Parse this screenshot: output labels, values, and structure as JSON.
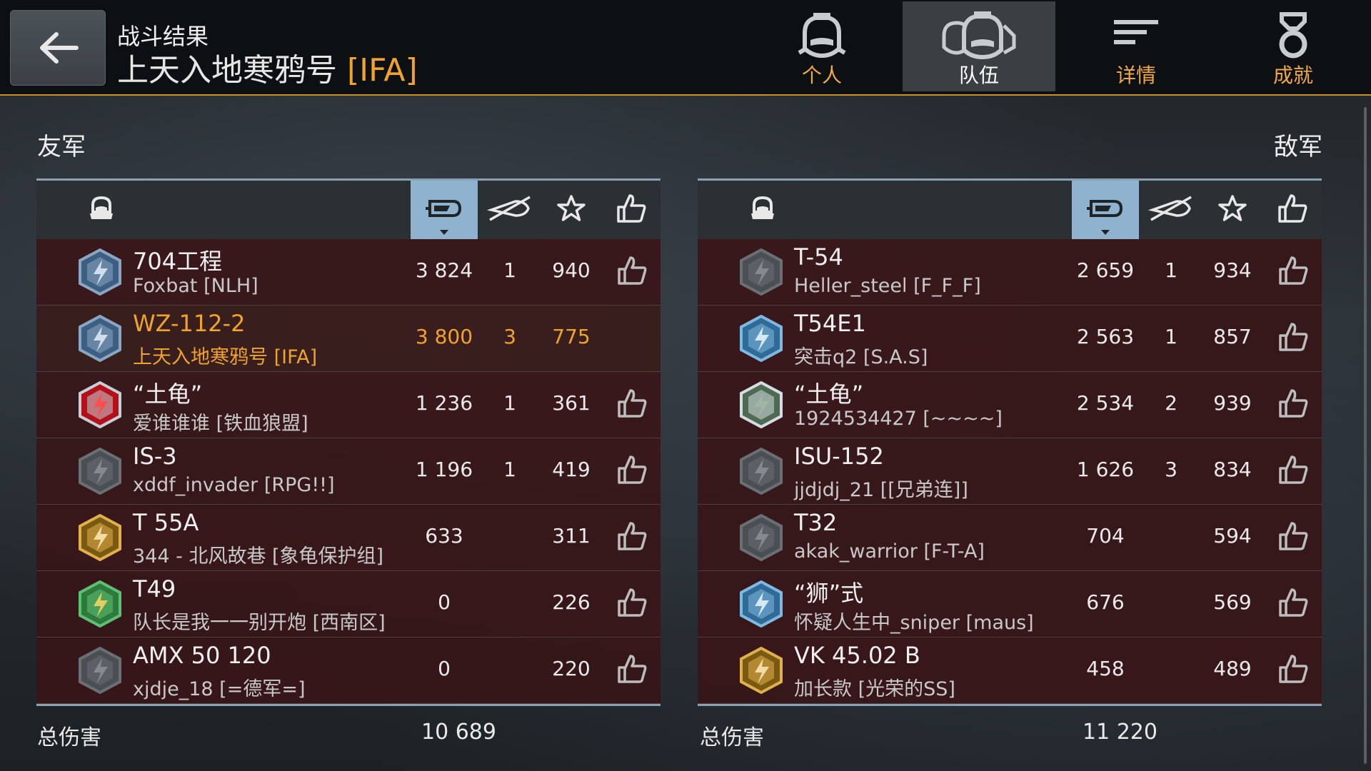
{
  "header": {
    "back_label": "back",
    "subtitle": "战斗结果",
    "title": "上天入地寒鸦号",
    "title_clan": "[IFA]"
  },
  "tabs": [
    {
      "label": "个人",
      "icon": "personal-helmet-icon",
      "active": false
    },
    {
      "label": "队伍",
      "icon": "team-helmets-icon",
      "active": true
    },
    {
      "label": "详情",
      "icon": "details-lines-icon",
      "active": false
    },
    {
      "label": "成就",
      "icon": "medal-icon",
      "active": false
    }
  ],
  "allies": {
    "title": "友军",
    "columns": [
      "tank-icon",
      "damage-icon",
      "kills-icon",
      "experience-star-icon",
      "like-icon"
    ],
    "rows": [
      {
        "tank": "704工程",
        "player": "Foxbat [NLH]",
        "damage": "3 824",
        "kills": "1",
        "xp": "940",
        "tier_icon": "tier-blue-icon",
        "like": true,
        "is_player": false
      },
      {
        "tank": "WZ-112-2",
        "player": "上天入地寒鸦号 [IFA]",
        "damage": "3 800",
        "kills": "3",
        "xp": "775",
        "tier_icon": "tier-blue-icon",
        "like": false,
        "is_player": true
      },
      {
        "tank": "“土龟”",
        "player": "爱谁谁谁 [铁血狼盟]",
        "damage": "1 236",
        "kills": "1",
        "xp": "361",
        "tier_icon": "tier-red-icon",
        "like": true,
        "is_player": false
      },
      {
        "tank": "IS-3",
        "player": "xddf_invader [RPG!!]",
        "damage": "1 196",
        "kills": "1",
        "xp": "419",
        "tier_icon": "tier-gray-icon",
        "like": true,
        "is_player": false
      },
      {
        "tank": "T 55A",
        "player": "344 - 北风故巷 [象龟保护组]",
        "damage": "633",
        "kills": "",
        "xp": "311",
        "tier_icon": "tier-gold-icon",
        "like": true,
        "is_player": false
      },
      {
        "tank": "T49",
        "player": "队长是我一一别开炮 [西南区]",
        "damage": "0",
        "kills": "",
        "xp": "226",
        "tier_icon": "tier-green-icon",
        "like": true,
        "is_player": false
      },
      {
        "tank": "AMX 50 120",
        "player": "xjdje_18 [=德军=]",
        "damage": "0",
        "kills": "",
        "xp": "220",
        "tier_icon": "tier-gray-icon",
        "like": true,
        "is_player": false
      }
    ],
    "total_label": "总伤害",
    "total_value": "10 689"
  },
  "enemies": {
    "title": "敌军",
    "columns": [
      "tank-icon",
      "damage-icon",
      "kills-icon",
      "experience-star-icon",
      "like-icon"
    ],
    "rows": [
      {
        "tank": "T-54",
        "player": "Heller_steel [F_F_F]",
        "damage": "2 659",
        "kills": "1",
        "xp": "934",
        "tier_icon": "tier-gray-icon",
        "like": true,
        "is_player": false
      },
      {
        "tank": "T54E1",
        "player": "突击q2 [S.A.S]",
        "damage": "2 563",
        "kills": "1",
        "xp": "857",
        "tier_icon": "tier-blue-wolf-icon",
        "like": true,
        "is_player": false
      },
      {
        "tank": "“土龟”",
        "player": "1924534427 [~~~~]",
        "damage": "2 534",
        "kills": "2",
        "xp": "939",
        "tier_icon": "tier-camo-icon",
        "like": true,
        "is_player": false
      },
      {
        "tank": "ISU-152",
        "player": "jjdjdj_21 [[兄弟连]]",
        "damage": "1 626",
        "kills": "3",
        "xp": "834",
        "tier_icon": "tier-gray-icon",
        "like": true,
        "is_player": false
      },
      {
        "tank": "T32",
        "player": "akak_warrior [F-T-A]",
        "damage": "704",
        "kills": "",
        "xp": "594",
        "tier_icon": "tier-gray-icon",
        "like": true,
        "is_player": false
      },
      {
        "tank": "“狮”式",
        "player": "怀疑人生中_sniper [maus]",
        "damage": "676",
        "kills": "",
        "xp": "569",
        "tier_icon": "tier-blue-wolf-icon",
        "like": true,
        "is_player": false
      },
      {
        "tank": "VK 45.02 B",
        "player": "加长款 [光荣的SS]",
        "damage": "458",
        "kills": "",
        "xp": "489",
        "tier_icon": "tier-gold-icon",
        "like": true,
        "is_player": false
      }
    ],
    "total_label": "总伤害",
    "total_value": "11 220"
  },
  "colors": {
    "accent": "#f0a32b",
    "row_bg": "#381618",
    "header_bg": "#2b3034",
    "selected_column": "#8fb3cf",
    "divider": "#c9902a"
  }
}
